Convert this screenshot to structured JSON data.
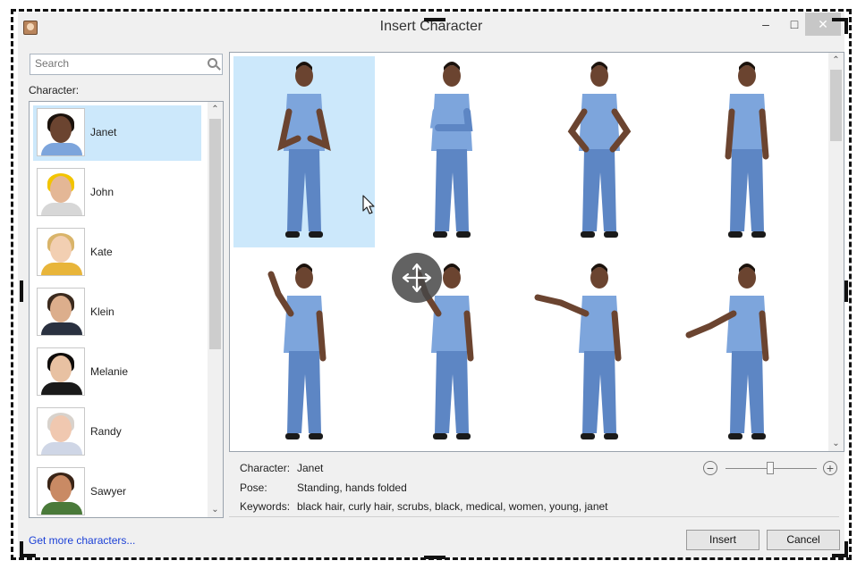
{
  "window": {
    "title": "Insert Character",
    "min_glyph": "–",
    "max_glyph": "□",
    "close_glyph": "✕"
  },
  "search": {
    "placeholder": "Search",
    "value": ""
  },
  "character_list": {
    "label": "Character:",
    "items": [
      {
        "name": "Janet",
        "selected": true,
        "skin": "#6b4430",
        "hair": "#1b120c",
        "shirt": "#7da5dc"
      },
      {
        "name": "John",
        "selected": false,
        "skin": "#e4b796",
        "hair": "#f2c400",
        "shirt": "#d7d7d7"
      },
      {
        "name": "Kate",
        "selected": false,
        "skin": "#f2cfb2",
        "hair": "#d9b46a",
        "shirt": "#e8b53a"
      },
      {
        "name": "Klein",
        "selected": false,
        "skin": "#dcae8c",
        "hair": "#3b2a1e",
        "shirt": "#2a3140"
      },
      {
        "name": "Melanie",
        "selected": false,
        "skin": "#e8c1a2",
        "hair": "#0f0c0a",
        "shirt": "#1a1a1a"
      },
      {
        "name": "Randy",
        "selected": false,
        "skin": "#f0c8b0",
        "hair": "#d8d2cc",
        "shirt": "#cfd6e6"
      },
      {
        "name": "Sawyer",
        "selected": false,
        "skin": "#c98a64",
        "hair": "#3a2416",
        "shirt": "#4a7a3a"
      }
    ]
  },
  "details": {
    "character_label": "Character:",
    "character_value": "Janet",
    "pose_label": "Pose:",
    "pose_value": "Standing, hands folded",
    "keywords_label": "Keywords:",
    "keywords_value": "black hair, curly hair, scrubs, black, medical, women, young, janet"
  },
  "zoom": {
    "minus": "−",
    "plus": "+",
    "level": 0.5
  },
  "footer": {
    "more_link": "Get more characters...",
    "insert_label": "Insert",
    "cancel_label": "Cancel"
  },
  "scroll_arrows": {
    "up": "⌃",
    "down": "⌄"
  },
  "colors": {
    "selection": "#cce8fb",
    "scrubs": "#7da5dc",
    "scrubs_dark": "#5d86c4",
    "skin": "#6b4430",
    "link": "#1a3fd6"
  }
}
